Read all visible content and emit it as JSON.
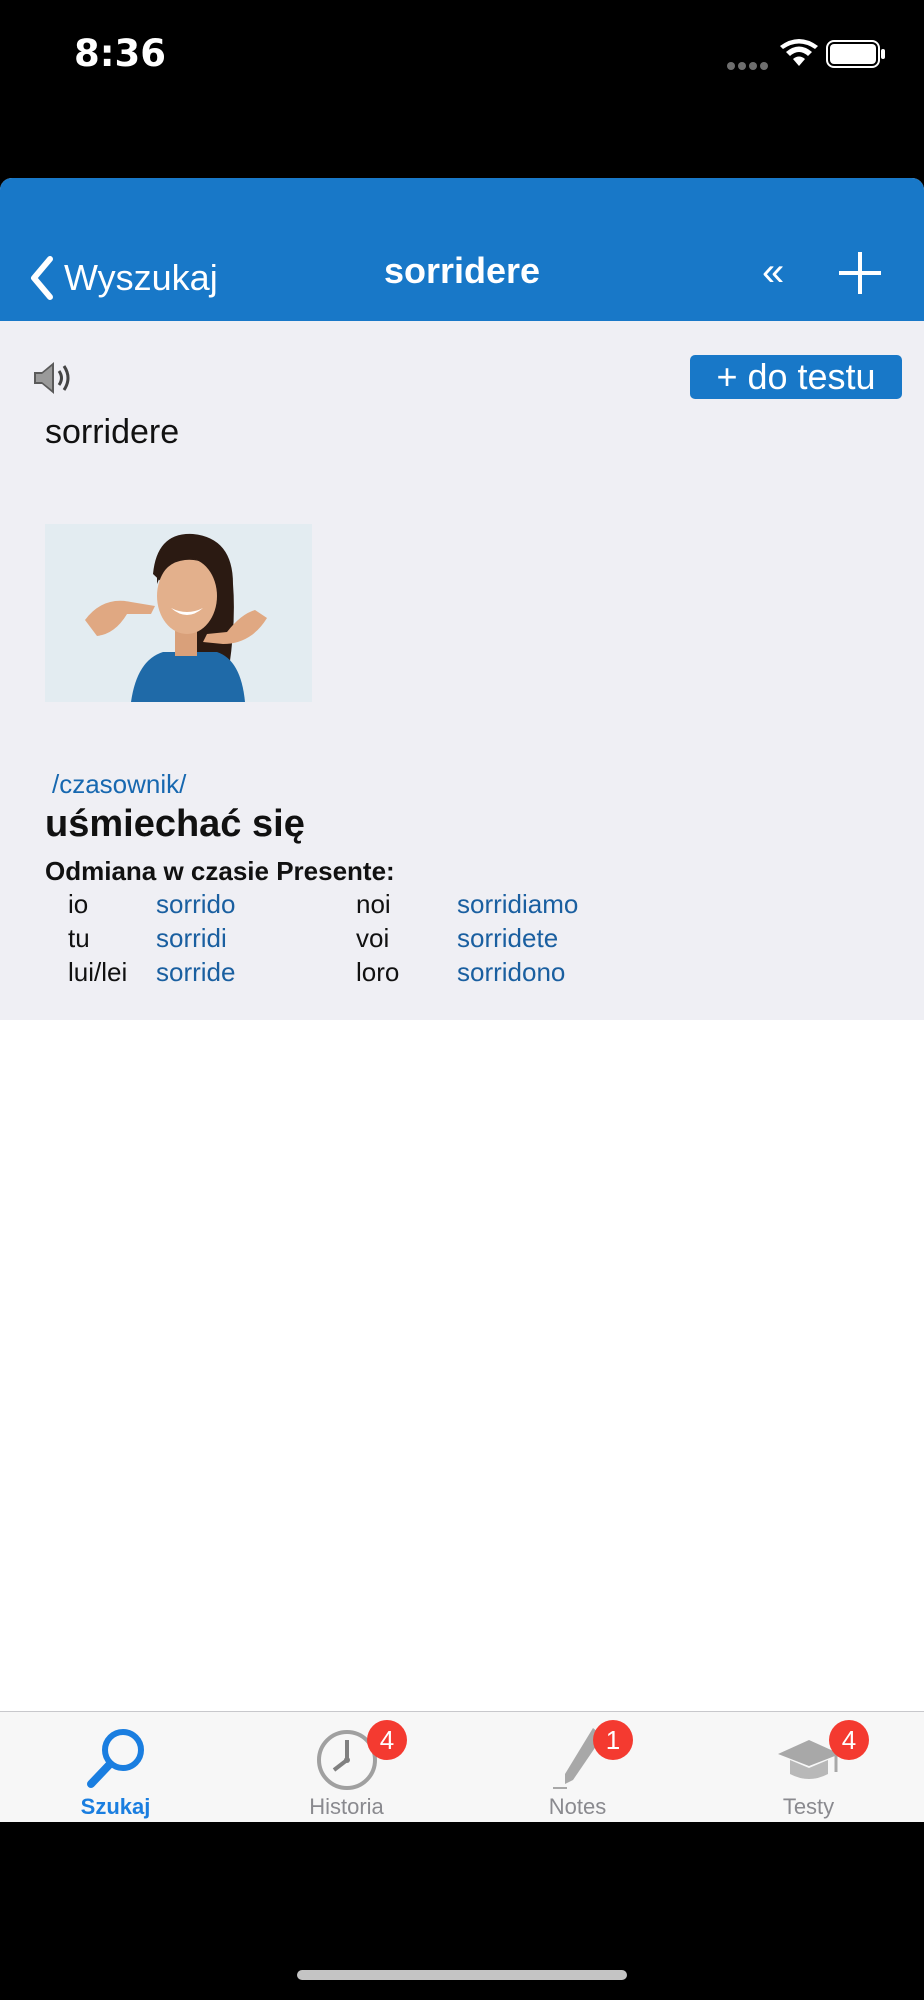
{
  "status_bar": {
    "time": "8:36"
  },
  "nav": {
    "back_label": "Wyszukaj",
    "title": "sorridere",
    "prev_symbol": "«"
  },
  "entry": {
    "headword": "sorridere",
    "add_to_test_label": "+ do testu",
    "part_of_speech": "/czasownik/",
    "translation": "uśmiechać się",
    "conjugation_title": "Odmiana w czasie Presente:",
    "conjugation": [
      {
        "p1": "io",
        "f1": "sorrido",
        "p2": "noi",
        "f2": "sorridiamo"
      },
      {
        "p1": "tu",
        "f1": "sorridi",
        "p2": "voi",
        "f2": "sorridete"
      },
      {
        "p1": "lui/lei",
        "f1": "sorride",
        "p2": "loro",
        "f2": "sorridono"
      }
    ]
  },
  "tabs": [
    {
      "label": "Szukaj",
      "icon": "magnifier-icon",
      "active": true,
      "badge": ""
    },
    {
      "label": "Historia",
      "icon": "clock-icon",
      "active": false,
      "badge": "4"
    },
    {
      "label": "Notes",
      "icon": "pen-icon",
      "active": false,
      "badge": "1"
    },
    {
      "label": "Testy",
      "icon": "graduation-cap-icon",
      "active": false,
      "badge": "4"
    }
  ],
  "colors": {
    "nav_blue": "#1878c8",
    "link_blue": "#1a5fa0",
    "active_tab": "#1a7ee0",
    "badge_red": "#f43a30"
  }
}
